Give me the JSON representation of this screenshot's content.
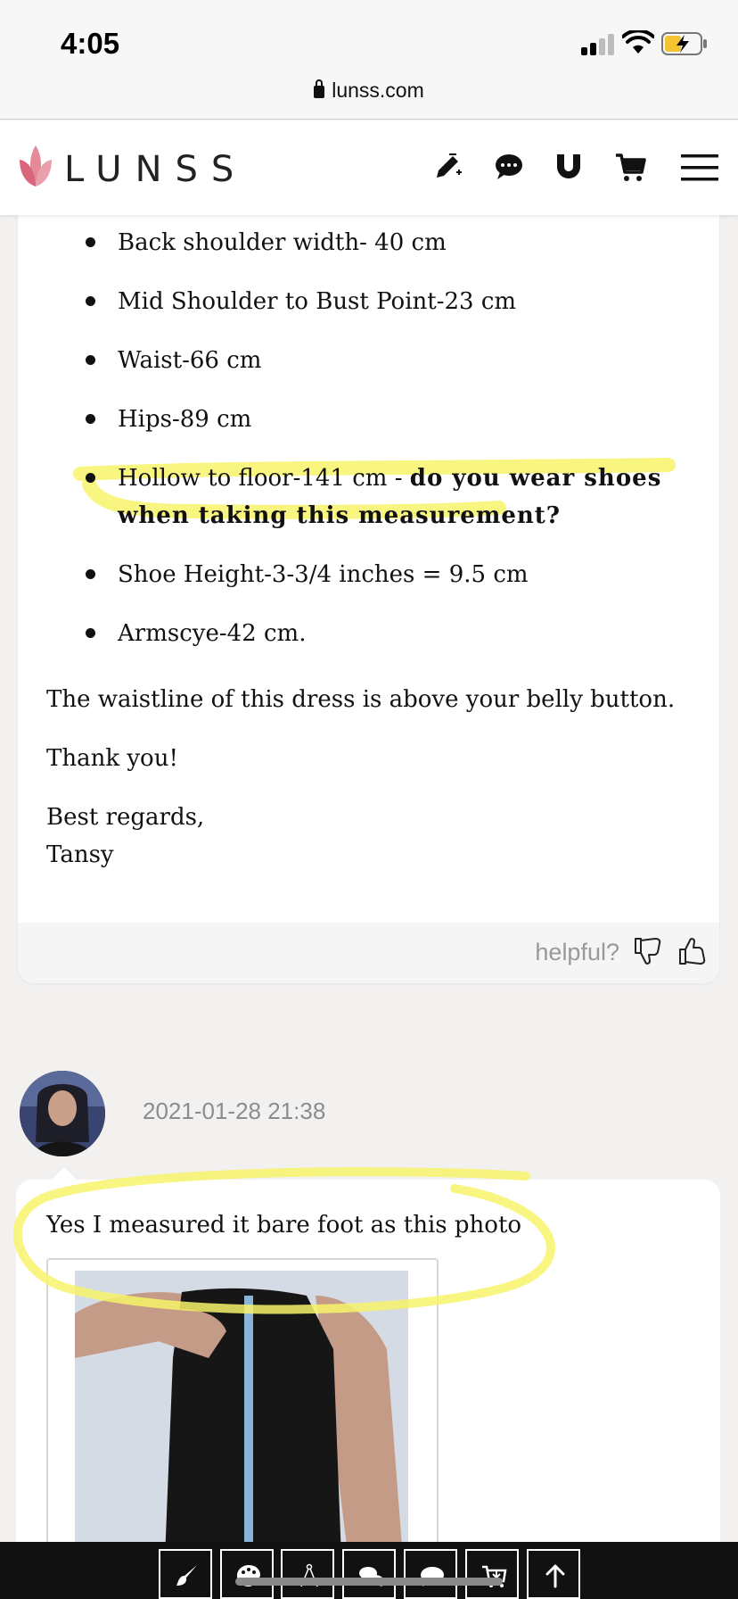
{
  "status_bar": {
    "time": "4:05",
    "url": "lunss.com"
  },
  "header": {
    "brand": "LUNSS",
    "icons": [
      "pencil-icon",
      "chat-icon",
      "magnet-icon",
      "cart-icon",
      "menu-icon"
    ]
  },
  "first_comment": {
    "measurements": [
      "Back shoulder width- 40 cm",
      "Mid Shoulder to Bust Point-23 cm",
      "Waist-66 cm",
      "Hips-89 cm"
    ],
    "hollow_item": {
      "plain": "Hollow to floor-141 cm - ",
      "bold_line1": "do you wear shoes",
      "bold_line2": "when taking this measurement?"
    },
    "measurements_after": [
      "Shoe Height-3-3/4 inches = 9.5 cm",
      "Armscye-42 cm."
    ],
    "paragraph": "The waistline of this dress is above your belly button.",
    "thanks": "Thank you!",
    "regards": "Best regards,",
    "signature": "Tansy",
    "helpful_label": "helpful?"
  },
  "second_comment": {
    "date": "2021-01-28 21:38",
    "text": "Yes I measured it bare foot as this photo"
  },
  "toolbar": {
    "buttons": [
      "brush-icon",
      "palette-icon",
      "compass-icon",
      "chat-bubbles-icon",
      "speech-bubble-icon",
      "cart-download-icon",
      "arrow-up-icon"
    ]
  },
  "colors": {
    "highlight": "#f7f36a",
    "toolbar_bg": "#111111",
    "brand_pink": "#e07a8a"
  }
}
